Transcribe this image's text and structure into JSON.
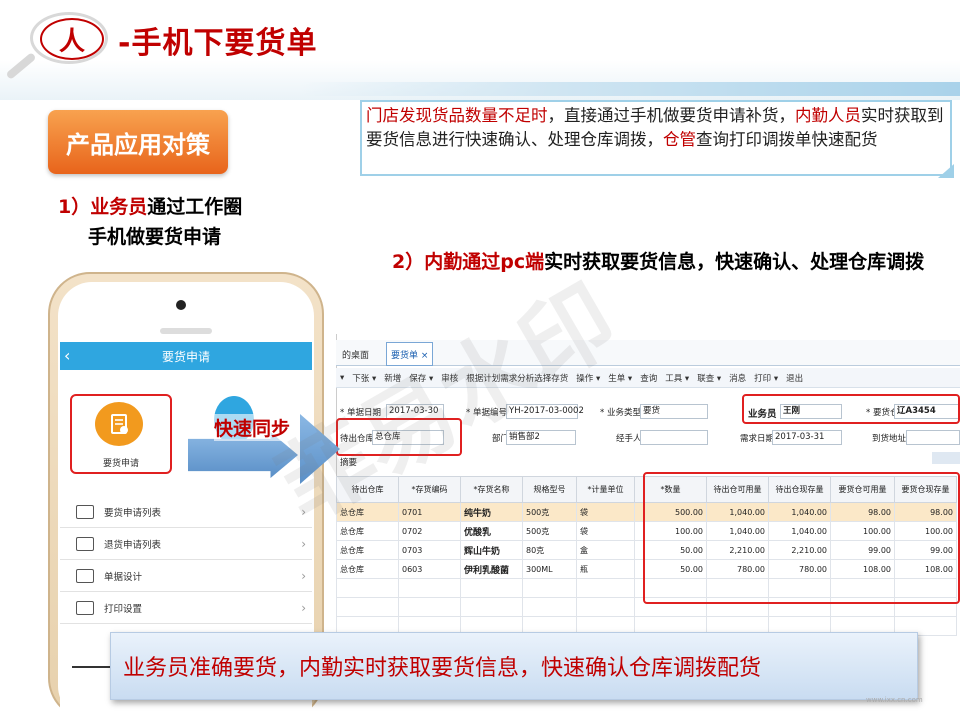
{
  "header": {
    "circle_char": "人",
    "title": "-手机下要货单"
  },
  "badge": "产品应用对策",
  "description": {
    "parts": [
      {
        "text": "门店发现货品数量不足时",
        "red": true
      },
      {
        "text": "，直接通过手机做要货申请补货，",
        "red": false
      },
      {
        "text": "内勤人员",
        "red": true
      },
      {
        "text": "实时获取到要货信息进行快速确认、处理仓库调拨，",
        "red": false
      },
      {
        "text": "仓管",
        "red": true
      },
      {
        "text": "查询打印调拨单快速配货",
        "red": false
      }
    ]
  },
  "step1": {
    "num": "1）",
    "role": "业务员",
    "rest": "通过工作圈",
    "line2": "手机做要货申请"
  },
  "step2": {
    "num": "2）",
    "role": "内勤通过pc端",
    "rest": "实时获取要货信息，快速确认、处理仓库调拨"
  },
  "phone": {
    "app_title": "要货申请",
    "tile_label": "要货申请",
    "menu": [
      "要货申请列表",
      "退货申请列表",
      "单据设计",
      "打印设置"
    ]
  },
  "sync_label": "快速同步",
  "erp": {
    "tabs": [
      "的桌面",
      "要货单 ×"
    ],
    "toolbar": [
      "▾",
      "下张 ▾",
      "新增",
      "保存 ▾",
      "审核",
      "根据计划需求分析选择存货",
      "操作 ▾",
      "生单 ▾",
      "查询",
      "工具 ▾",
      "联查 ▾",
      "消息",
      "打印 ▾",
      "退出"
    ],
    "form": {
      "doc_date_label": "* 单据日期",
      "doc_date": "2017-03-30",
      "doc_no_label": "* 单据编号",
      "doc_no": "YH-2017-03-0002",
      "biz_type_label": "* 业务类型",
      "biz_type": "要货",
      "salesman_label": "业务员",
      "salesman": "王刚",
      "req_wh_label": "* 要货仓库",
      "req_wh": "辽A3454",
      "out_wh_label": "待出仓库",
      "out_wh": "总仓库",
      "dept_label": "部门",
      "dept": "销售部2",
      "handler_label": "经手人",
      "handler": "",
      "need_date_label": "需求日期",
      "need_date": "2017-03-31",
      "addr_label": "到货地址",
      "addr": "",
      "summary_label": "摘要"
    },
    "columns": [
      "待出仓库",
      "*存货编码",
      "*存货名称",
      "规格型号",
      "*计量单位",
      "*数量",
      "待出仓可用量",
      "待出仓现存量",
      "要货仓可用量",
      "要货仓现存量"
    ],
    "rows": [
      [
        "总仓库",
        "0701",
        "纯牛奶",
        "500克",
        "袋",
        "500.00",
        "1,040.00",
        "1,040.00",
        "98.00",
        "98.00"
      ],
      [
        "总仓库",
        "0702",
        "优酸乳",
        "500克",
        "袋",
        "100.00",
        "1,040.00",
        "1,040.00",
        "100.00",
        "100.00"
      ],
      [
        "总仓库",
        "0703",
        "辉山牛奶",
        "80克",
        "盒",
        "50.00",
        "2,210.00",
        "2,210.00",
        "99.00",
        "99.00"
      ],
      [
        "总仓库",
        "0603",
        "伊利乳酸菌",
        "300ML",
        "瓶",
        "50.00",
        "780.00",
        "780.00",
        "108.00",
        "108.00"
      ]
    ]
  },
  "caption": "业务员准确要货，内勤实时获取要货信息，快速确认仓库调拨配货",
  "watermark": "菲易水印",
  "footer_url": "www.ixx.cn.com",
  "colors": {
    "accent_red": "#c00000",
    "app_blue": "#2fa6e0",
    "badge_orange": "#e8641b"
  }
}
